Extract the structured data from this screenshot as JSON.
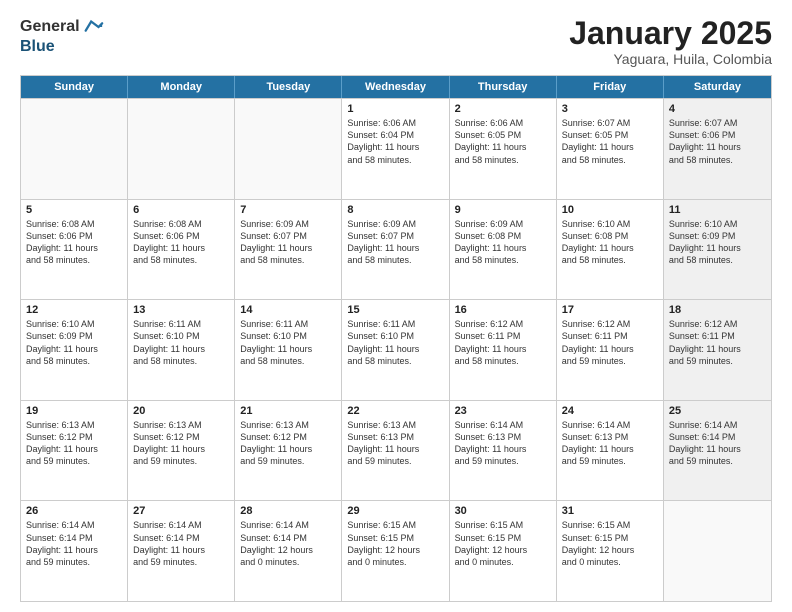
{
  "logo": {
    "general": "General",
    "blue": "Blue"
  },
  "title": "January 2025",
  "location": "Yaguara, Huila, Colombia",
  "days": [
    "Sunday",
    "Monday",
    "Tuesday",
    "Wednesday",
    "Thursday",
    "Friday",
    "Saturday"
  ],
  "rows": [
    [
      {
        "day": "",
        "empty": true
      },
      {
        "day": "",
        "empty": true
      },
      {
        "day": "",
        "empty": true
      },
      {
        "day": "1",
        "text": "Sunrise: 6:06 AM\nSunset: 6:04 PM\nDaylight: 11 hours\nand 58 minutes."
      },
      {
        "day": "2",
        "text": "Sunrise: 6:06 AM\nSunset: 6:05 PM\nDaylight: 11 hours\nand 58 minutes."
      },
      {
        "day": "3",
        "text": "Sunrise: 6:07 AM\nSunset: 6:05 PM\nDaylight: 11 hours\nand 58 minutes."
      },
      {
        "day": "4",
        "text": "Sunrise: 6:07 AM\nSunset: 6:06 PM\nDaylight: 11 hours\nand 58 minutes.",
        "shaded": true
      }
    ],
    [
      {
        "day": "5",
        "text": "Sunrise: 6:08 AM\nSunset: 6:06 PM\nDaylight: 11 hours\nand 58 minutes."
      },
      {
        "day": "6",
        "text": "Sunrise: 6:08 AM\nSunset: 6:06 PM\nDaylight: 11 hours\nand 58 minutes."
      },
      {
        "day": "7",
        "text": "Sunrise: 6:09 AM\nSunset: 6:07 PM\nDaylight: 11 hours\nand 58 minutes."
      },
      {
        "day": "8",
        "text": "Sunrise: 6:09 AM\nSunset: 6:07 PM\nDaylight: 11 hours\nand 58 minutes."
      },
      {
        "day": "9",
        "text": "Sunrise: 6:09 AM\nSunset: 6:08 PM\nDaylight: 11 hours\nand 58 minutes."
      },
      {
        "day": "10",
        "text": "Sunrise: 6:10 AM\nSunset: 6:08 PM\nDaylight: 11 hours\nand 58 minutes."
      },
      {
        "day": "11",
        "text": "Sunrise: 6:10 AM\nSunset: 6:09 PM\nDaylight: 11 hours\nand 58 minutes.",
        "shaded": true
      }
    ],
    [
      {
        "day": "12",
        "text": "Sunrise: 6:10 AM\nSunset: 6:09 PM\nDaylight: 11 hours\nand 58 minutes."
      },
      {
        "day": "13",
        "text": "Sunrise: 6:11 AM\nSunset: 6:10 PM\nDaylight: 11 hours\nand 58 minutes."
      },
      {
        "day": "14",
        "text": "Sunrise: 6:11 AM\nSunset: 6:10 PM\nDaylight: 11 hours\nand 58 minutes."
      },
      {
        "day": "15",
        "text": "Sunrise: 6:11 AM\nSunset: 6:10 PM\nDaylight: 11 hours\nand 58 minutes."
      },
      {
        "day": "16",
        "text": "Sunrise: 6:12 AM\nSunset: 6:11 PM\nDaylight: 11 hours\nand 58 minutes."
      },
      {
        "day": "17",
        "text": "Sunrise: 6:12 AM\nSunset: 6:11 PM\nDaylight: 11 hours\nand 59 minutes."
      },
      {
        "day": "18",
        "text": "Sunrise: 6:12 AM\nSunset: 6:11 PM\nDaylight: 11 hours\nand 59 minutes.",
        "shaded": true
      }
    ],
    [
      {
        "day": "19",
        "text": "Sunrise: 6:13 AM\nSunset: 6:12 PM\nDaylight: 11 hours\nand 59 minutes."
      },
      {
        "day": "20",
        "text": "Sunrise: 6:13 AM\nSunset: 6:12 PM\nDaylight: 11 hours\nand 59 minutes."
      },
      {
        "day": "21",
        "text": "Sunrise: 6:13 AM\nSunset: 6:12 PM\nDaylight: 11 hours\nand 59 minutes."
      },
      {
        "day": "22",
        "text": "Sunrise: 6:13 AM\nSunset: 6:13 PM\nDaylight: 11 hours\nand 59 minutes."
      },
      {
        "day": "23",
        "text": "Sunrise: 6:14 AM\nSunset: 6:13 PM\nDaylight: 11 hours\nand 59 minutes."
      },
      {
        "day": "24",
        "text": "Sunrise: 6:14 AM\nSunset: 6:13 PM\nDaylight: 11 hours\nand 59 minutes."
      },
      {
        "day": "25",
        "text": "Sunrise: 6:14 AM\nSunset: 6:14 PM\nDaylight: 11 hours\nand 59 minutes.",
        "shaded": true
      }
    ],
    [
      {
        "day": "26",
        "text": "Sunrise: 6:14 AM\nSunset: 6:14 PM\nDaylight: 11 hours\nand 59 minutes."
      },
      {
        "day": "27",
        "text": "Sunrise: 6:14 AM\nSunset: 6:14 PM\nDaylight: 11 hours\nand 59 minutes."
      },
      {
        "day": "28",
        "text": "Sunrise: 6:14 AM\nSunset: 6:14 PM\nDaylight: 12 hours\nand 0 minutes."
      },
      {
        "day": "29",
        "text": "Sunrise: 6:15 AM\nSunset: 6:15 PM\nDaylight: 12 hours\nand 0 minutes."
      },
      {
        "day": "30",
        "text": "Sunrise: 6:15 AM\nSunset: 6:15 PM\nDaylight: 12 hours\nand 0 minutes."
      },
      {
        "day": "31",
        "text": "Sunrise: 6:15 AM\nSunset: 6:15 PM\nDaylight: 12 hours\nand 0 minutes."
      },
      {
        "day": "",
        "empty": true,
        "shaded": true
      }
    ]
  ]
}
